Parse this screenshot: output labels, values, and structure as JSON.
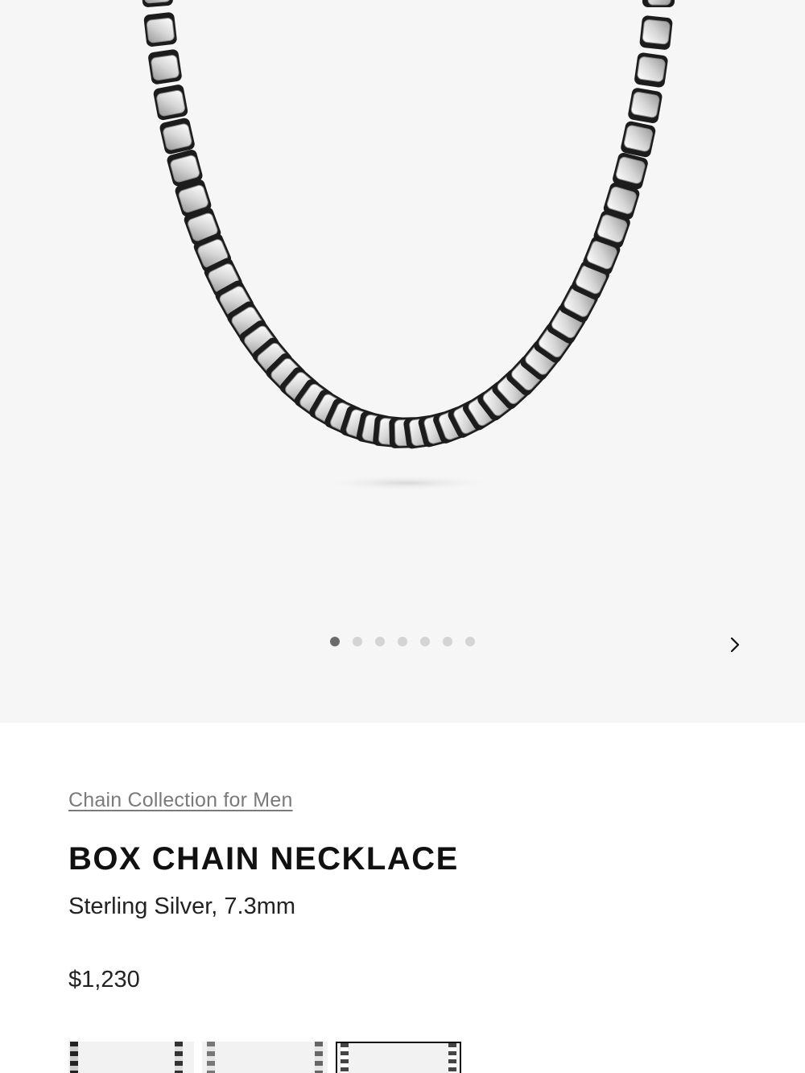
{
  "gallery": {
    "image_alt": "Box Chain Necklace",
    "slide_count": 7,
    "active_slide": 1,
    "next_icon": "chevron-right-icon"
  },
  "product": {
    "breadcrumb": "Chain Collection for Men",
    "title": "BOX CHAIN NECKLACE",
    "subtitle": "Sterling Silver, 7.3mm",
    "price": "$1,230"
  },
  "variants": [
    {
      "name": "variant-thumb-1",
      "selected": false
    },
    {
      "name": "variant-thumb-2",
      "selected": false
    },
    {
      "name": "variant-thumb-3",
      "selected": true
    }
  ],
  "colors": {
    "hero_bg": "#f6f6f6",
    "link_gray": "#7a7a7a",
    "dot_active": "#6b6b6b",
    "dot_inactive": "#d4d4d4"
  }
}
